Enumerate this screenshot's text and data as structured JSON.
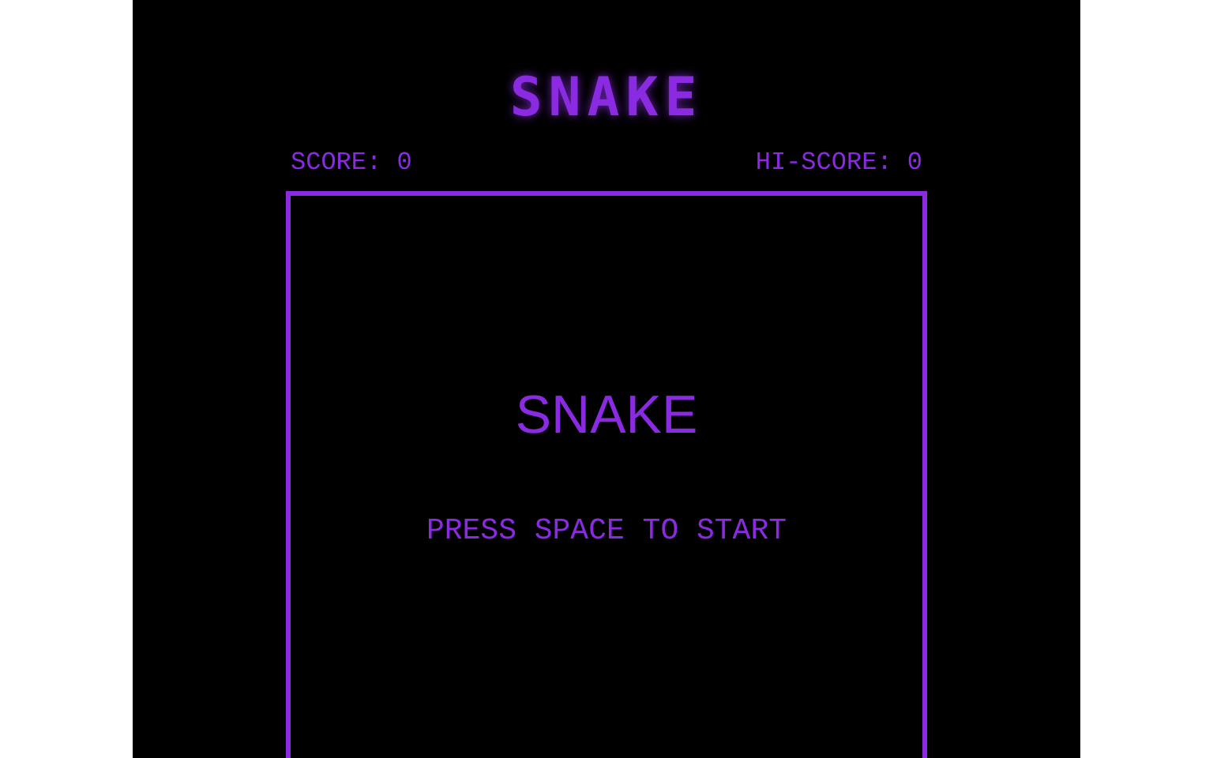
{
  "title": "SNAKE",
  "score": {
    "label": "SCORE: 0"
  },
  "hi_score": {
    "label": "HI-SCORE: 0"
  },
  "board": {
    "title": "SNAKE",
    "prompt": "PRESS SPACE TO START"
  }
}
